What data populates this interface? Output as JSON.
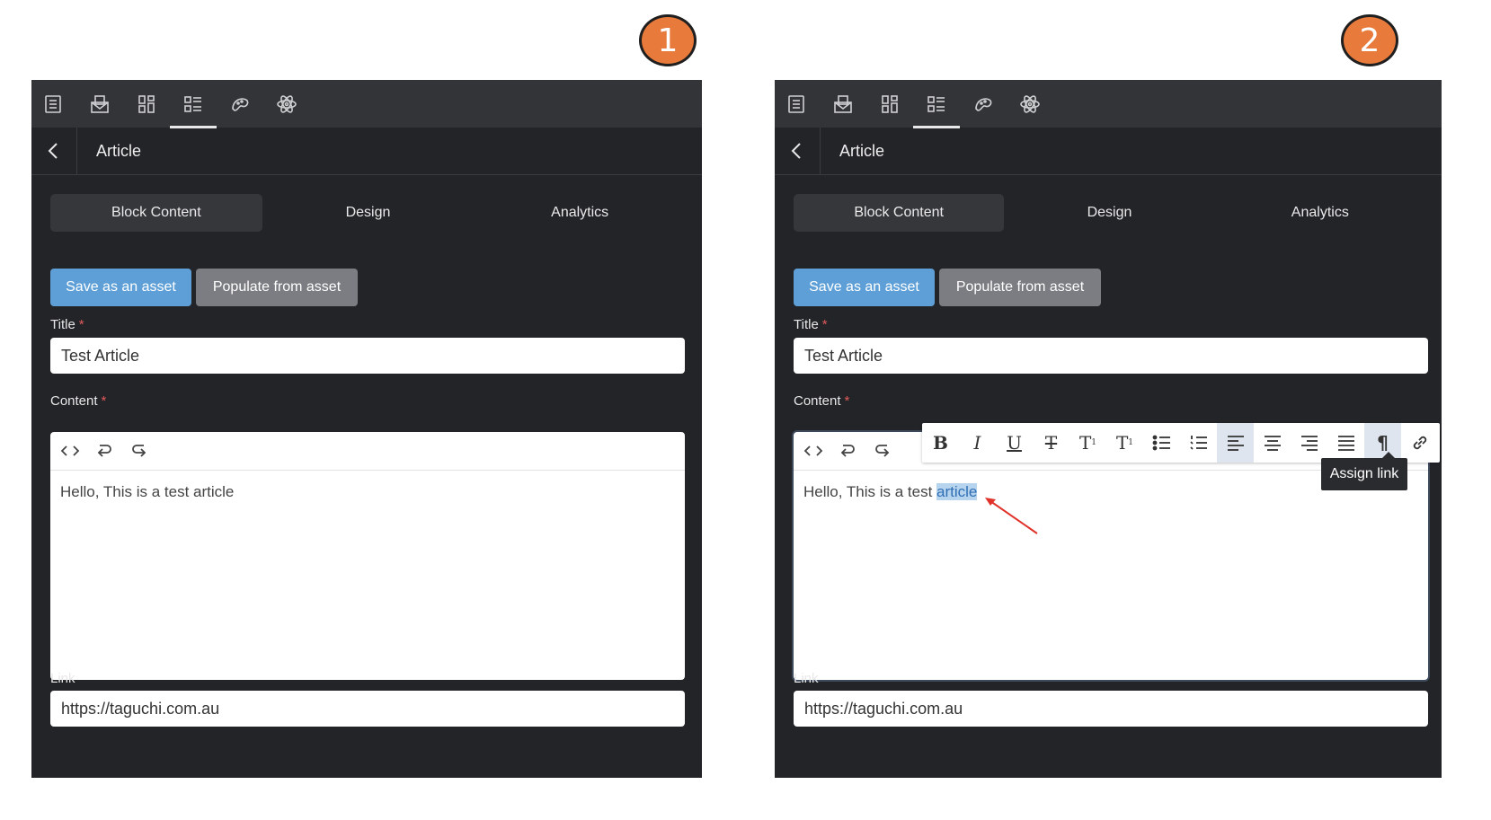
{
  "badges": {
    "first": "1",
    "second": "2"
  },
  "top_icons": [
    "page-icon",
    "email-icon",
    "layout-icon",
    "list-blocks-icon",
    "palette-icon",
    "atom-icon"
  ],
  "panels": [
    {
      "page_title": "Article",
      "tabs": [
        "Block Content",
        "Design",
        "Analytics"
      ],
      "active_tab": "Block Content",
      "save_asset_label": "Save as an asset",
      "populate_asset_label": "Populate from asset",
      "title_label": "Title",
      "title_value": "Test Article",
      "content_label": "Content",
      "content_text": "Hello, This is a test article",
      "link_label": "Link",
      "link_value": "https://taguchi.com.au"
    },
    {
      "page_title": "Article",
      "tabs": [
        "Block Content",
        "Design",
        "Analytics"
      ],
      "active_tab": "Block Content",
      "save_asset_label": "Save as an asset",
      "populate_asset_label": "Populate from asset",
      "title_label": "Title",
      "title_value": "Test Article",
      "content_label": "Content",
      "content_text_before": "Hello, This is a test ",
      "content_text_selected": "article",
      "link_label": "Link",
      "link_value": "https://taguchi.com.au",
      "tooltip": "Assign link",
      "rich_toolbar": [
        "bold-icon",
        "italic-icon",
        "underline-icon",
        "strikethrough-icon",
        "superscript-icon",
        "subscript-icon",
        "bullet-list-icon",
        "numbered-list-icon",
        "align-left-icon",
        "align-center-icon",
        "align-right-icon",
        "justify-icon",
        "paragraph-icon",
        "link-icon"
      ]
    }
  ],
  "required_marker": "*",
  "colors": {
    "accent_blue": "#5d9fd6",
    "badge_orange": "#e87a3b",
    "panel_bg": "#232428",
    "arrow_red": "#e0322a"
  }
}
